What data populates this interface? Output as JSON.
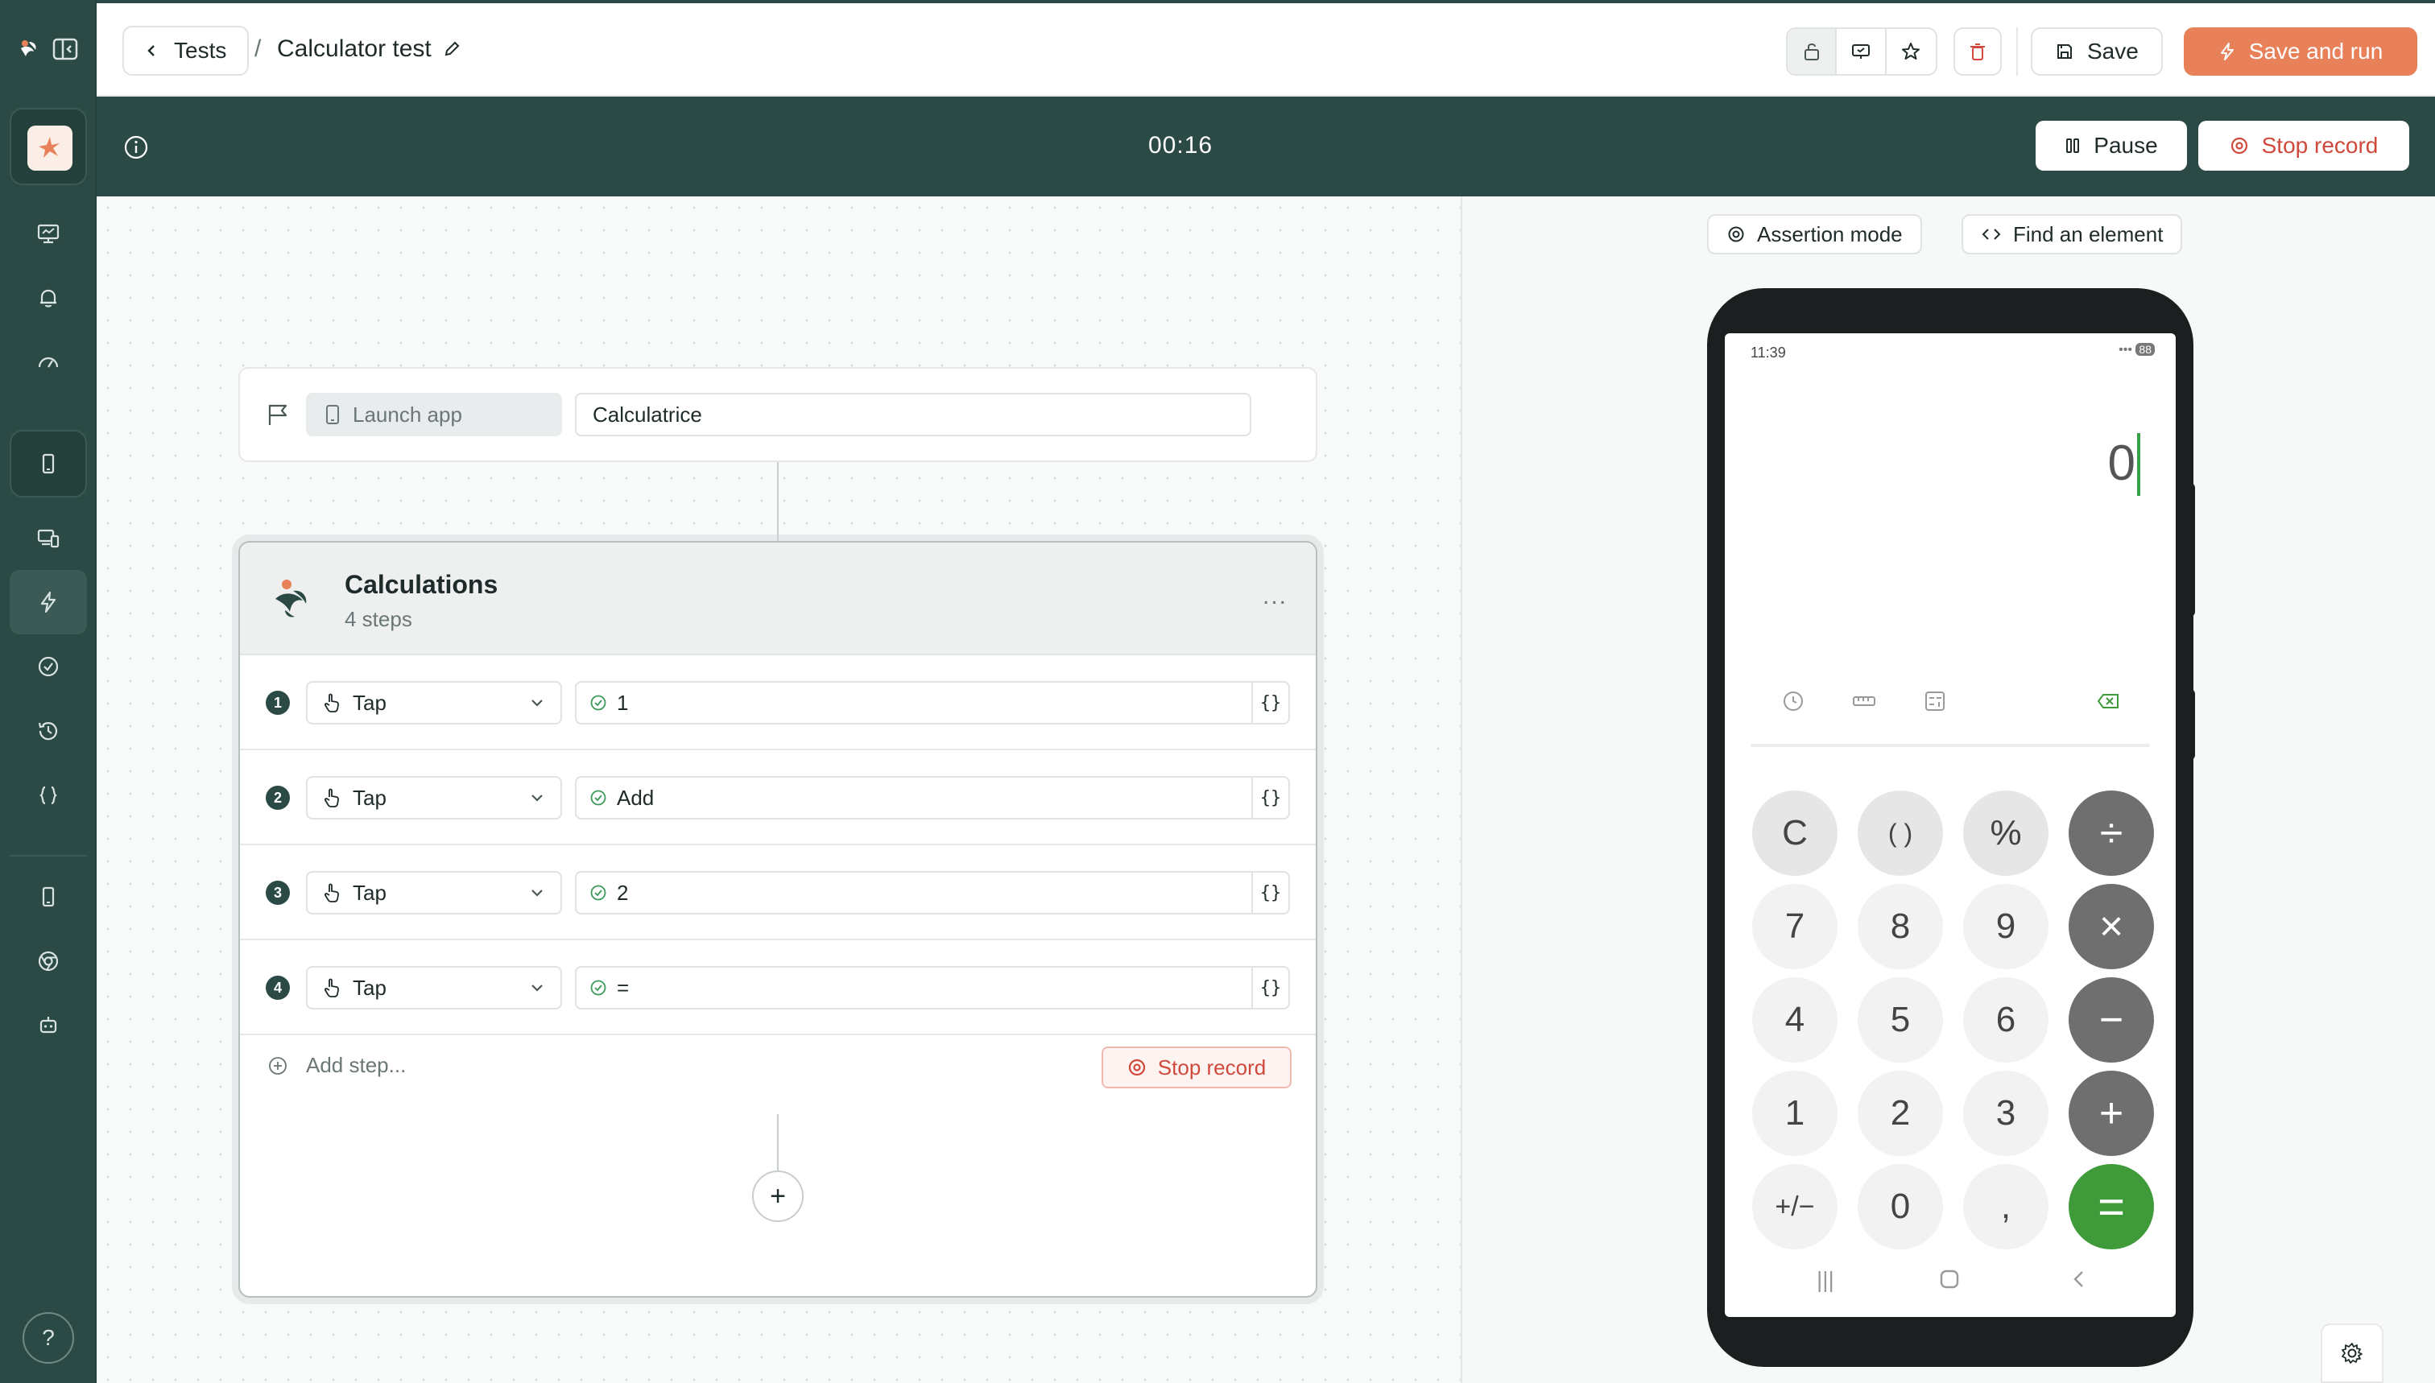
{
  "header": {
    "back_label": "Tests",
    "separator": "/",
    "test_title": "Calculator test",
    "save_label": "Save",
    "save_and_run_label": "Save and run"
  },
  "recording": {
    "timer": "00:16",
    "pause_label": "Pause",
    "stop_label": "Stop record"
  },
  "launch": {
    "action_label": "Launch app",
    "app_name": "Calculatrice"
  },
  "group": {
    "title": "Calculations",
    "subtitle": "4 steps",
    "more": "..."
  },
  "steps": [
    {
      "number": "1",
      "action": "Tap",
      "target": "1",
      "var": "{}"
    },
    {
      "number": "2",
      "action": "Tap",
      "target": "Add",
      "var": "{}"
    },
    {
      "number": "3",
      "action": "Tap",
      "target": "2",
      "var": "{}"
    },
    {
      "number": "4",
      "action": "Tap",
      "target": "=",
      "var": "{}"
    }
  ],
  "footer": {
    "add_step_label": "Add step...",
    "stop_record_label": "Stop record",
    "add_node": "+"
  },
  "device_panel": {
    "assertion_mode_label": "Assertion mode",
    "find_element_label": "Find an element"
  },
  "phone": {
    "status_time": "11:39",
    "battery": "88",
    "display_value": "0",
    "keys": {
      "clear": "C",
      "parens": "( )",
      "percent": "%",
      "divide": "÷",
      "seven": "7",
      "eight": "8",
      "nine": "9",
      "multiply": "×",
      "four": "4",
      "five": "5",
      "six": "6",
      "minus": "−",
      "one": "1",
      "two": "2",
      "three": "3",
      "plus": "+",
      "sign": "+/−",
      "zero": "0",
      "comma": ",",
      "equals": "="
    }
  },
  "help_label": "?",
  "colors": {
    "brand_dark": "#2c4a45",
    "accent_orange": "#e8805a",
    "stop_red": "#d0493b",
    "equals_green": "#3f9b3a",
    "operator_gray": "#6f6f6f"
  }
}
